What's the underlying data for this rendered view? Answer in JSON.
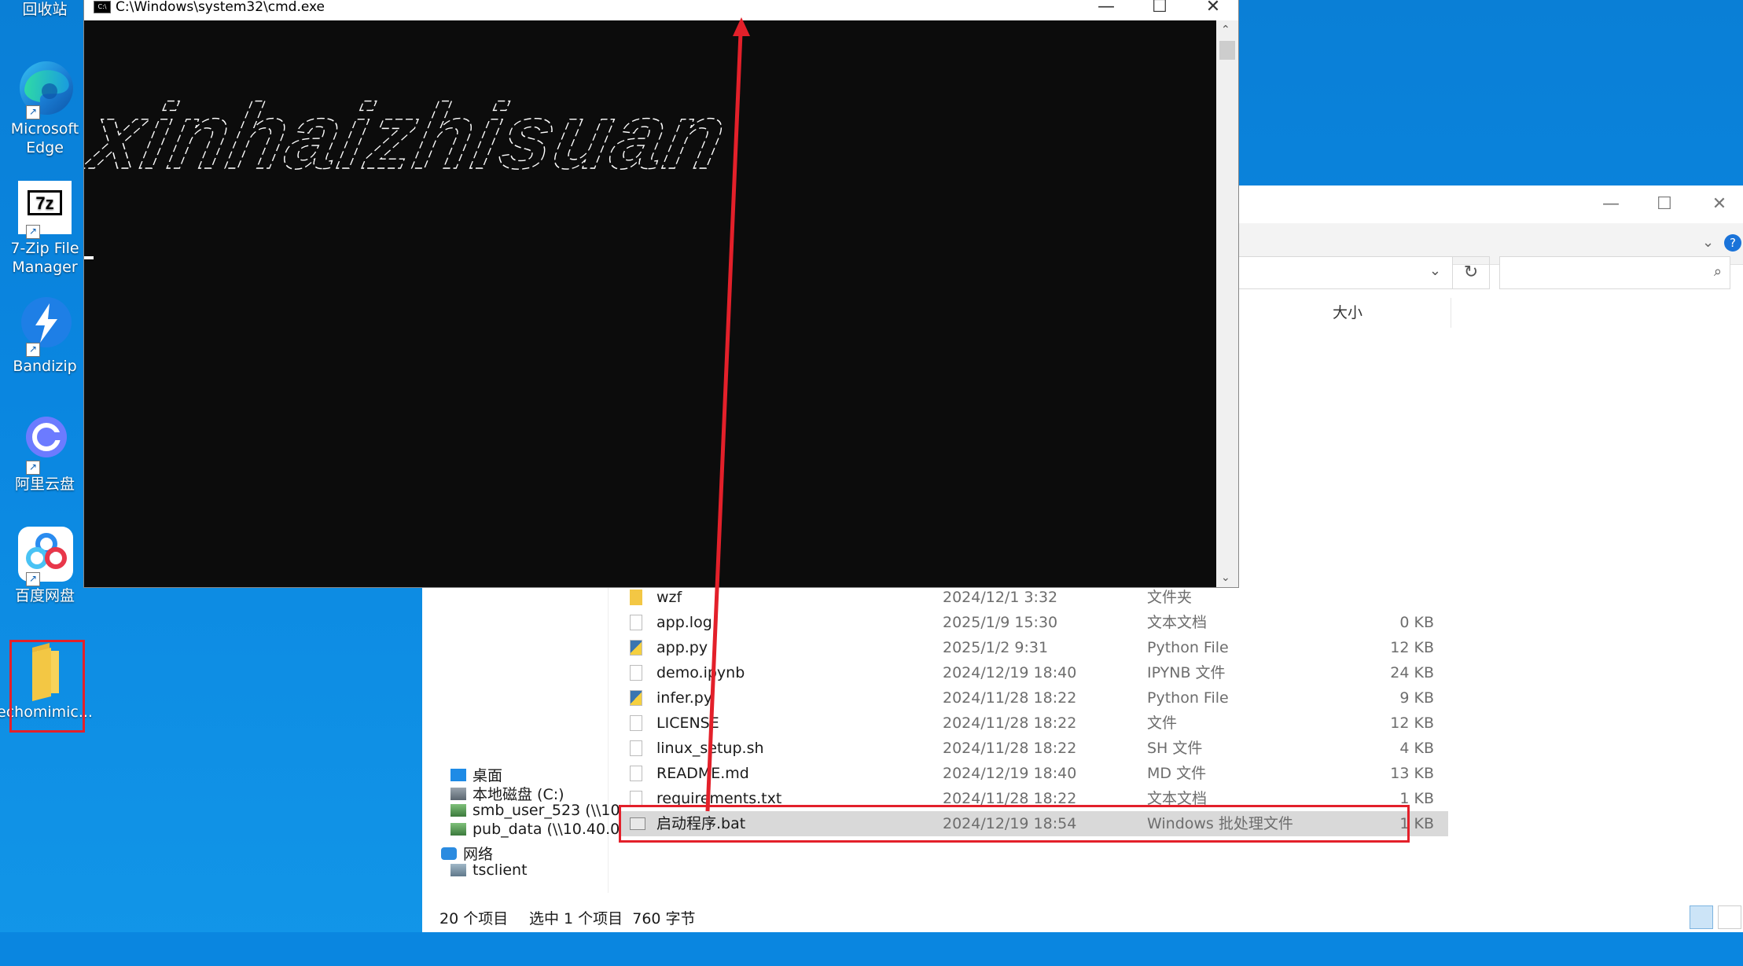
{
  "desktop": {
    "icons": [
      {
        "label": "回收站"
      },
      {
        "label": "Microsoft Edge"
      },
      {
        "label": "7-Zip File Manager"
      },
      {
        "label": "Bandizip"
      },
      {
        "label": "阿里云盘"
      },
      {
        "label": "百度网盘"
      },
      {
        "label": "echomimic..."
      }
    ]
  },
  "cmd": {
    "title": "C:\\Windows\\system32\\cmd.exe",
    "ascii_banner": "xinhaizhisuan"
  },
  "explorer": {
    "column_size": "大小",
    "nav": [
      {
        "label": "桌面"
      },
      {
        "label": "本地磁盘 (C:)"
      },
      {
        "label": "smb_user_523 (\\\\10"
      },
      {
        "label": "pub_data (\\\\10.40.0"
      },
      {
        "label": "网络"
      },
      {
        "label": "tsclient"
      }
    ],
    "files": [
      {
        "name": "wzf",
        "date": "2024/12/1 3:32",
        "type": "文件夹",
        "size": ""
      },
      {
        "name": "app.log",
        "date": "2025/1/9 15:30",
        "type": "文本文档",
        "size": "0 KB"
      },
      {
        "name": "app.py",
        "date": "2025/1/2 9:31",
        "type": "Python File",
        "size": "12 KB"
      },
      {
        "name": "demo.ipynb",
        "date": "2024/12/19 18:40",
        "type": "IPYNB 文件",
        "size": "24 KB"
      },
      {
        "name": "infer.py",
        "date": "2024/11/28 18:22",
        "type": "Python File",
        "size": "9 KB"
      },
      {
        "name": "LICENSE",
        "date": "2024/11/28 18:22",
        "type": "文件",
        "size": "12 KB"
      },
      {
        "name": "linux_setup.sh",
        "date": "2024/11/28 18:22",
        "type": "SH 文件",
        "size": "4 KB"
      },
      {
        "name": "README.md",
        "date": "2024/12/19 18:40",
        "type": "MD 文件",
        "size": "13 KB"
      },
      {
        "name": "requirements.txt",
        "date": "2024/11/28 18:22",
        "type": "文本文档",
        "size": "1 KB"
      },
      {
        "name": "启动程序.bat",
        "date": "2024/12/19 18:54",
        "type": "Windows 批处理文件",
        "size": "1 KB"
      }
    ],
    "status": {
      "count": "20 个项目",
      "selection": "选中 1 个项目  760 字节"
    }
  },
  "colors": {
    "highlight": "#e3202a",
    "desktop": "#0a86e0",
    "console": "#0c0c0c"
  }
}
